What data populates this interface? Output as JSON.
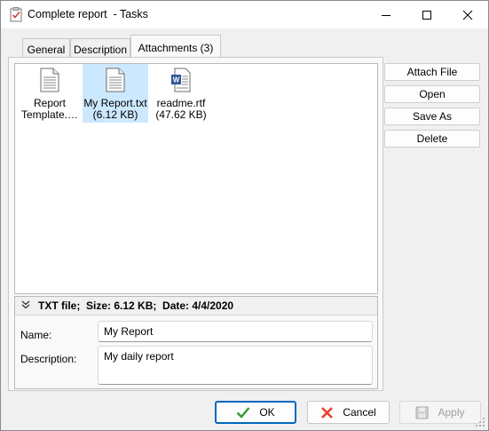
{
  "window": {
    "title": "Complete report  - Tasks",
    "icons": [
      "clipboard-check-icon",
      "minimize-icon",
      "maximize-icon",
      "close-icon"
    ]
  },
  "tabs": [
    {
      "label": "General"
    },
    {
      "label": "Description"
    },
    {
      "label": "Attachments (3)",
      "active": true
    }
  ],
  "files": [
    {
      "name": "Report Template.…",
      "name_line1": "Report",
      "name_line2": "Template.…",
      "icon": "text-document-icon",
      "selected": false
    },
    {
      "name_line1": "My Report.txt",
      "name_line2": "(6.12 KB)",
      "icon": "text-document-icon",
      "selected": true
    },
    {
      "name_line1": "readme.rtf",
      "name_line2": "(47.62 KB)",
      "icon": "word-document-icon",
      "selected": false
    }
  ],
  "details": {
    "info": "TXT file;  Size: 6.12 KB;  Date: 4/4/2020",
    "name_label": "Name:",
    "name_value": "My Report",
    "description_label": "Description:",
    "description_value": "My daily report"
  },
  "side_buttons": {
    "attach": "Attach File",
    "open": "Open",
    "save_as": "Save As",
    "delete": "Delete"
  },
  "bottom_buttons": {
    "ok": "OK",
    "cancel": "Cancel",
    "apply": "Apply"
  },
  "colors": {
    "accent": "#0067c0",
    "selection": "#cce8ff",
    "ok_check": "#2e9e2e",
    "cancel_x": "#e8402a"
  }
}
